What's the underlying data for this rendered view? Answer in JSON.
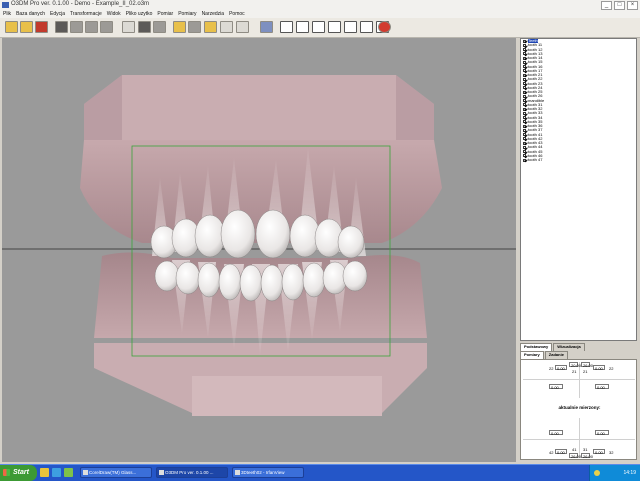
{
  "window": {
    "title": "O3DM Pro ver. 0.1.00 - Demo - Example_II_02.o3m",
    "buttons": [
      "_",
      "□",
      "×"
    ]
  },
  "menubar": [
    "Plik",
    "Baza danych",
    "Edycja",
    "Transformacje",
    "Widok",
    "Pliko uzytko",
    "Pomiar",
    "Pomiary",
    "Narzedzia",
    "Pomoc"
  ],
  "toolbar_icons": [
    "new-file-icon",
    "open-file-icon",
    "save-icon",
    "print-icon",
    "grid-icon",
    "model-icon",
    "wire-icon",
    "rotate-icon",
    "layers-icon",
    "lock-icon",
    "file-icon",
    "save-disk-icon",
    "folder-icon",
    "stop-icon",
    "copy-icon",
    "view-left-icon",
    "view-top-icon",
    "view-front-icon",
    "teeth-upper-icon",
    "teeth-lower-icon",
    "teeth-front-icon",
    "teeth-side-icon",
    "teeth-occlusal-icon",
    "stop-red-icon"
  ],
  "tree": {
    "items": [
      "Teeth",
      "tooth 11",
      "tooth 12",
      "tooth 13",
      "tooth 14",
      "tooth 15",
      "tooth 16",
      "tooth 17",
      "tooth 21",
      "tooth 22",
      "tooth 23",
      "tooth 24",
      "tooth 25",
      "tooth 26",
      "mandible",
      "tooth 31",
      "tooth 32",
      "tooth 33",
      "tooth 34",
      "tooth 35",
      "tooth 36",
      "tooth 37",
      "tooth 41",
      "tooth 42",
      "tooth 43",
      "tooth 44",
      "tooth 45",
      "tooth 46",
      "tooth 47"
    ],
    "selected_index": 0
  },
  "panel": {
    "tabs_top": [
      "Podstawowy",
      "Wizualizacja"
    ],
    "tabs_bottom": [
      "Pomiary",
      "Zadanie"
    ],
    "top_labels": {
      "left_num": "22",
      "mid_a": "21",
      "mid_b": "21",
      "right_num": "22"
    },
    "top_fields": [
      "0.00",
      "20.00",
      "26.00",
      "0.00"
    ],
    "mid_fields": [
      "0.00",
      "0.00"
    ],
    "current_measured_title": "aktualnie mierzony:",
    "lower_fields": [
      "0.00",
      "0.00"
    ],
    "bottom_labels": {
      "left_num": "42",
      "mid_a": "41",
      "mid_b": "31",
      "right_num": "32"
    },
    "bottom_fields": [
      "0.00",
      "26.00",
      "26.00",
      "0.00"
    ]
  },
  "taskbar": {
    "start": "Start",
    "buttons": [
      "CorelDraw(TM) Glass...",
      "O3DM Pro ver. 0.1.00 ...",
      "3Dteeth02 - IrfanView"
    ],
    "clock": "14:19"
  },
  "colors": {
    "viewport_bg": "#9a9a9a",
    "gum": "#b89a9e",
    "tooth": "#f2eeec",
    "taskbar": "#2456c8",
    "selected": "#1f46b4"
  }
}
